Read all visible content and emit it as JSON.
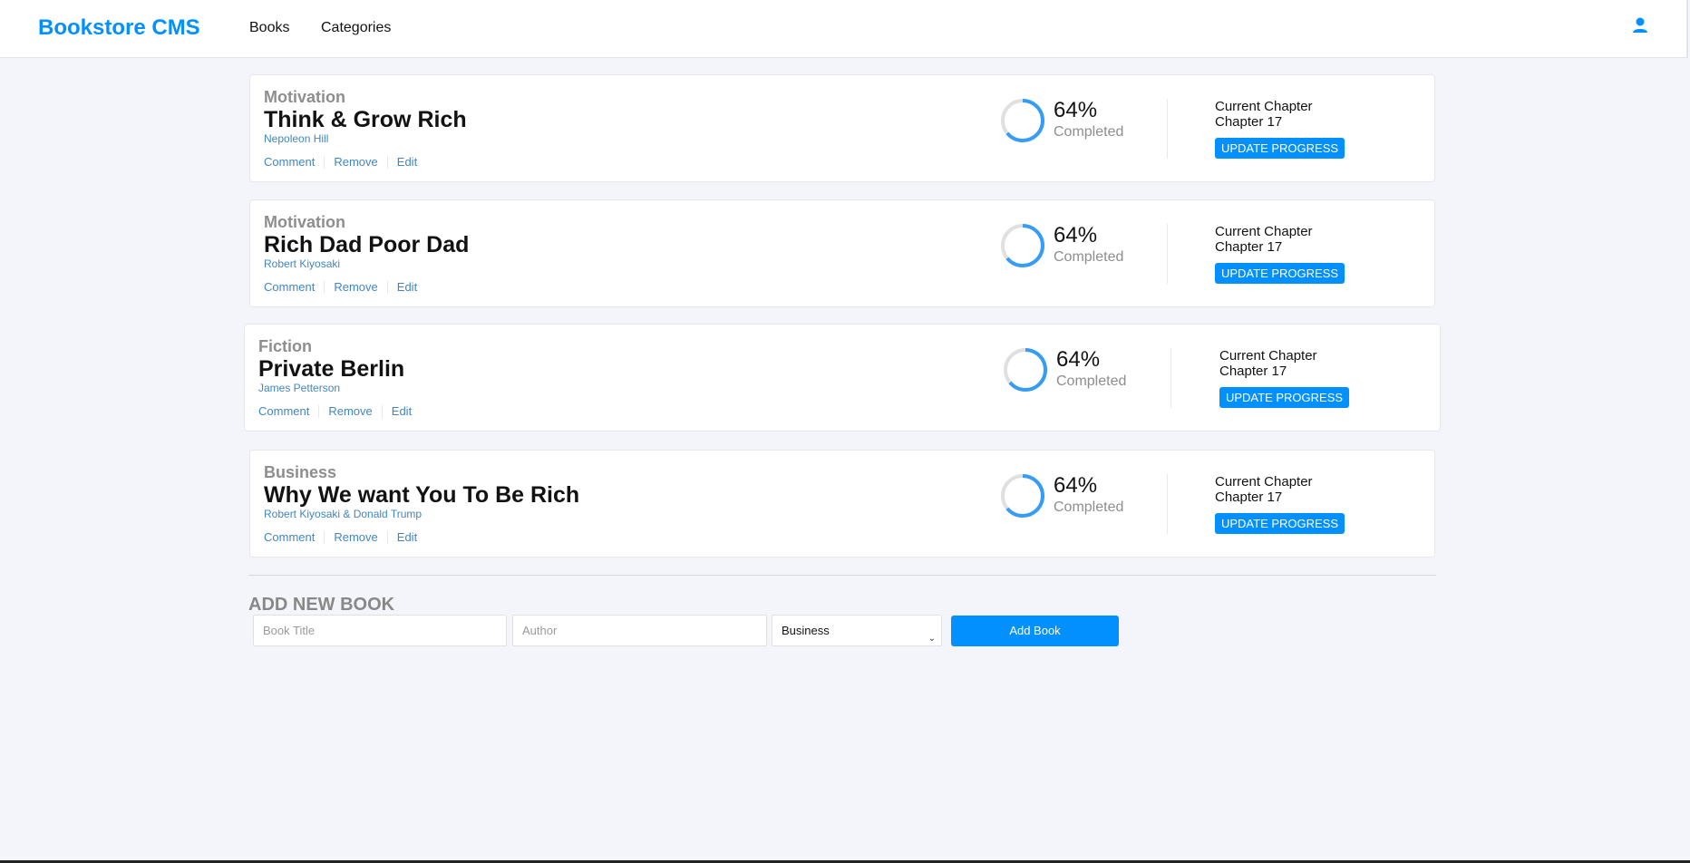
{
  "nav": {
    "brand": "Bookstore CMS",
    "links": [
      "Books",
      "Categories"
    ],
    "user_icon": "user-icon",
    "accent": "#0290ff"
  },
  "books": [
    {
      "genre": "Motivation",
      "title": "Think & Grow Rich",
      "author": "Nepoleon Hill",
      "actions": [
        "Comment",
        "Remove",
        "Edit"
      ],
      "progress_percent": 64,
      "percent_label": "64%",
      "completed_label": "Completed",
      "chapter_label": "Current Chapter",
      "chapter": "Chapter 17",
      "update_label": "UPDATE PROGRESS"
    },
    {
      "genre": "Motivation",
      "title": "Rich Dad Poor Dad",
      "author": "Robert Kiyosaki",
      "actions": [
        "Comment",
        "Remove",
        "Edit"
      ],
      "progress_percent": 64,
      "percent_label": "64%",
      "completed_label": "Completed",
      "chapter_label": "Current Chapter",
      "chapter": "Chapter 17",
      "update_label": "UPDATE PROGRESS"
    },
    {
      "genre": "Fiction",
      "title": "Private Berlin",
      "author": "James Petterson",
      "actions": [
        "Comment",
        "Remove",
        "Edit"
      ],
      "progress_percent": 64,
      "percent_label": "64%",
      "completed_label": "Completed",
      "chapter_label": "Current Chapter",
      "chapter": "Chapter 17",
      "update_label": "UPDATE PROGRESS"
    },
    {
      "genre": "Business",
      "title": "Why We want You To Be Rich",
      "author": "Robert Kiyosaki & Donald Trump",
      "actions": [
        "Comment",
        "Remove",
        "Edit"
      ],
      "progress_percent": 64,
      "percent_label": "64%",
      "completed_label": "Completed",
      "chapter_label": "Current Chapter",
      "chapter": "Chapter 17",
      "update_label": "UPDATE PROGRESS"
    }
  ],
  "add_form": {
    "heading": "ADD NEW BOOK",
    "title_placeholder": "Book Title",
    "author_placeholder": "Author",
    "category_selected": "Business",
    "submit_label": "Add Book"
  }
}
